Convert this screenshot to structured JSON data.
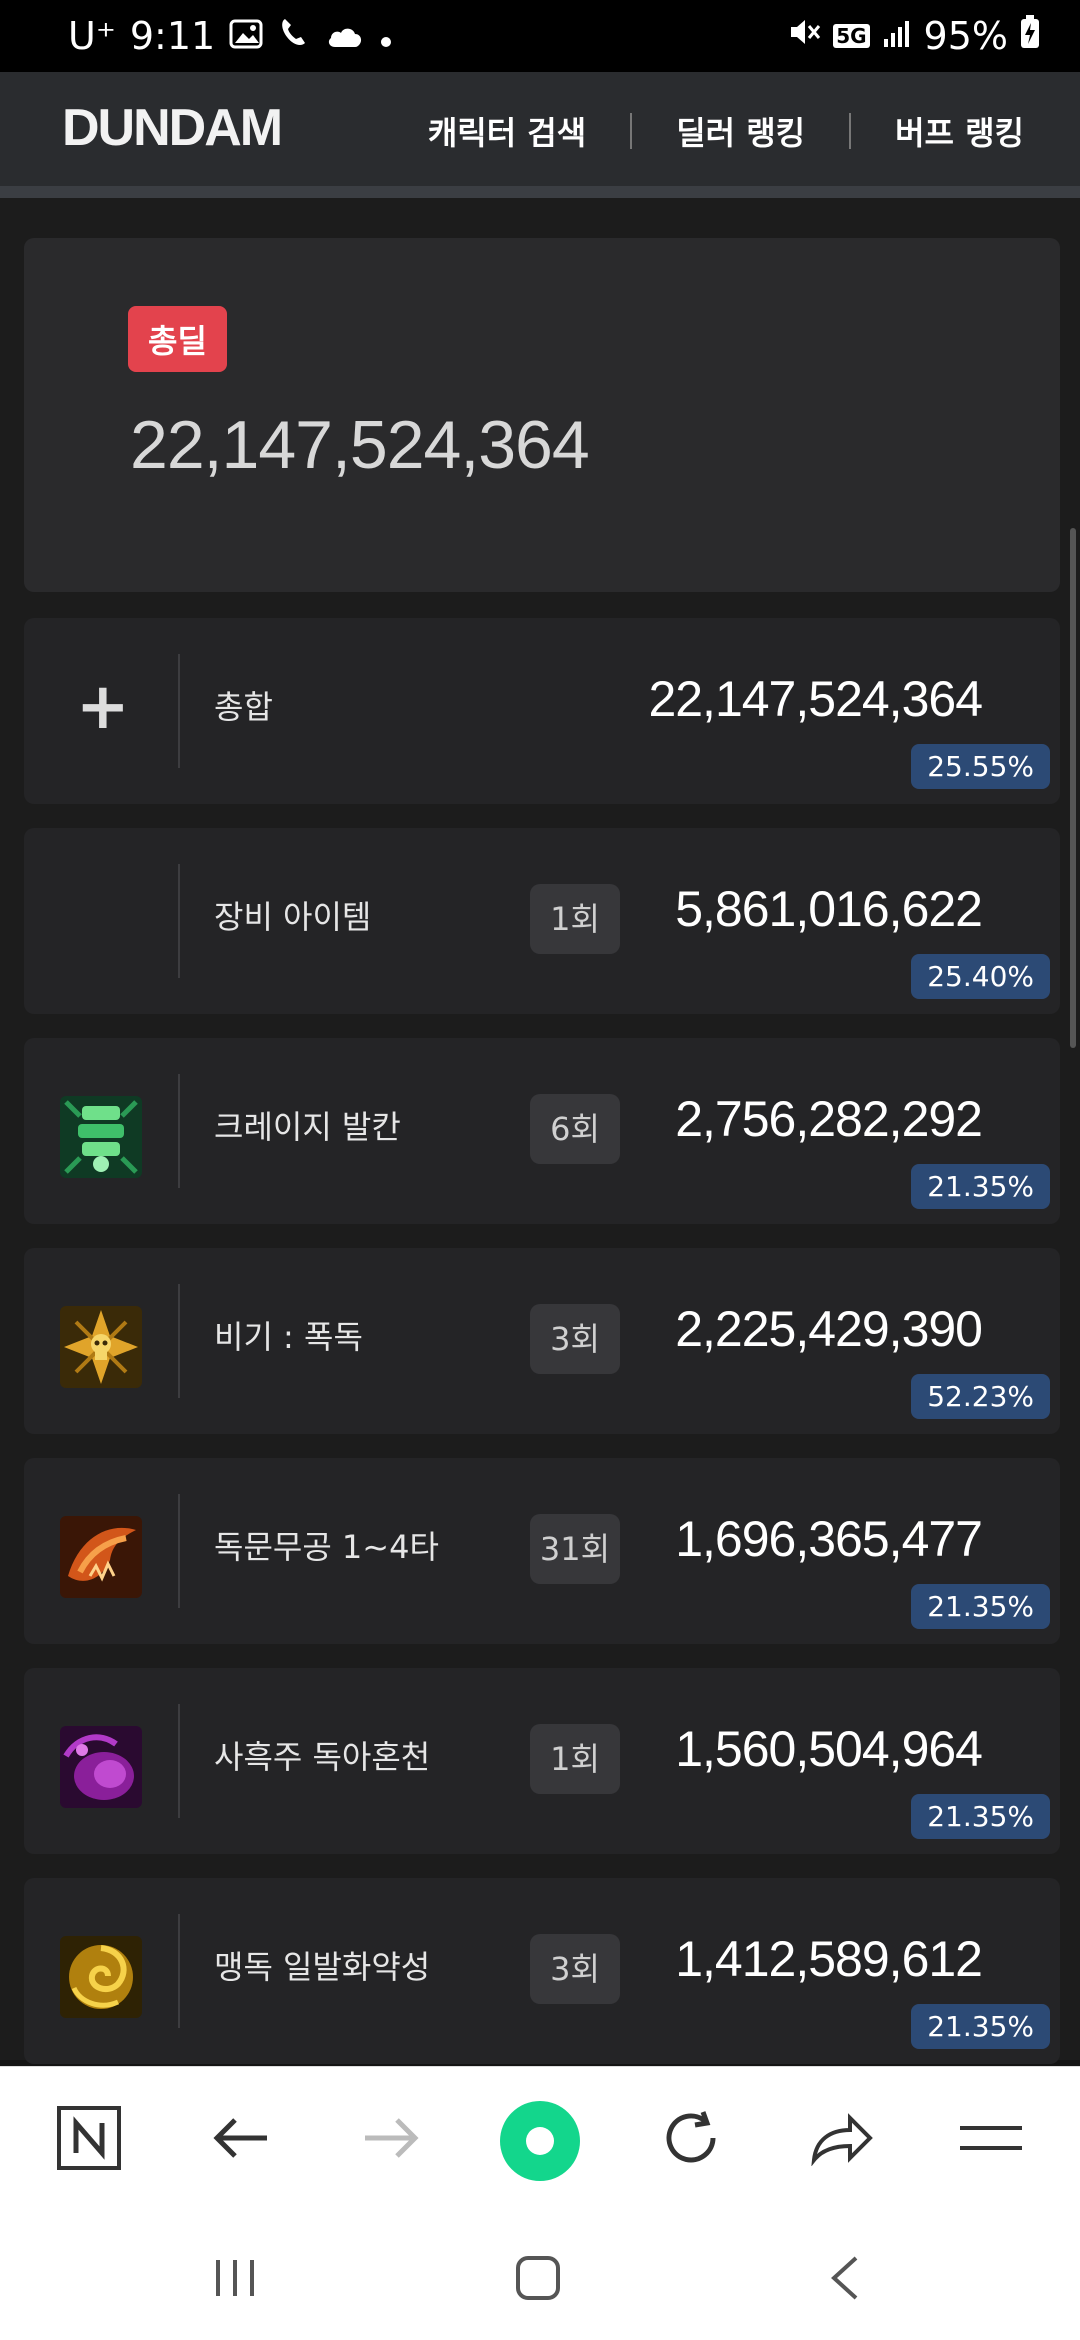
{
  "status": {
    "carrier": "U⁺",
    "time": "9:11",
    "network": "5G",
    "battery": "95%"
  },
  "header": {
    "logo": "DUNDAM",
    "nav": [
      "캐릭터 검색",
      "딜러 랭킹",
      "버프 랭킹"
    ]
  },
  "summary": {
    "badge": "총딜",
    "total": "22,147,524,364"
  },
  "rows": [
    {
      "name": "총합",
      "count": "",
      "value": "22,147,524,364",
      "pct": "25.55%",
      "icon": "plus-icon"
    },
    {
      "name": "장비 아이템",
      "count": "1회",
      "value": "5,861,016,622",
      "pct": "25.40%",
      "icon": ""
    },
    {
      "name": "크레이지 발칸",
      "count": "6회",
      "value": "2,756,282,292",
      "pct": "21.35%",
      "icon": "crazy-vulcan-skill-icon"
    },
    {
      "name": "비기 : 폭독",
      "count": "3회",
      "value": "2,225,429,390",
      "pct": "52.23%",
      "icon": "poison-burst-skill-icon"
    },
    {
      "name": "독문무공 1~4타",
      "count": "31회",
      "value": "1,696,365,477",
      "pct": "21.35%",
      "icon": "poison-martial-skill-icon"
    },
    {
      "name": "사흑주 독아혼천",
      "count": "1회",
      "value": "1,560,504,964",
      "pct": "21.35%",
      "icon": "dark-spell-skill-icon"
    },
    {
      "name": "맹독 일발화약성",
      "count": "3회",
      "value": "1,412,589,612",
      "pct": "21.35%",
      "icon": "venom-gunpowder-skill-icon"
    }
  ],
  "colors": {
    "badge_red": "#e3434d",
    "pct_blue": "#2c4a75",
    "background": "#1c1c1c",
    "card": "#242426",
    "whale_green": "#13d68c"
  }
}
